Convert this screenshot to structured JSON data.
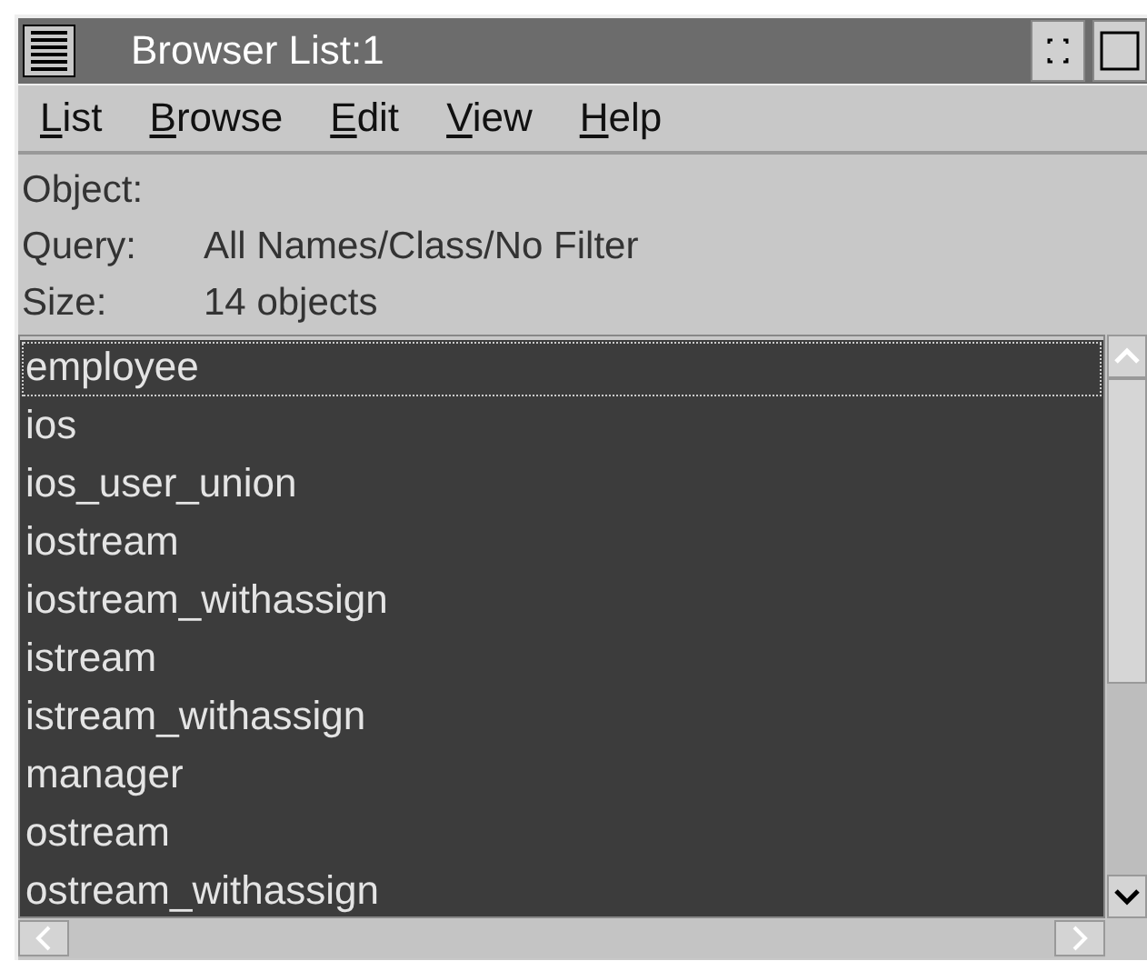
{
  "window": {
    "title": "Browser List:1"
  },
  "menu": [
    {
      "label": "List"
    },
    {
      "label": "Browse"
    },
    {
      "label": "Edit"
    },
    {
      "label": "View"
    },
    {
      "label": "Help"
    }
  ],
  "info": [
    {
      "label": "Object:"
    },
    {
      "label": "Query:",
      "value": "All Names/Class/No Filter"
    },
    {
      "label": "Size:",
      "value": "14 objects"
    }
  ],
  "list": [
    {
      "name": "employee",
      "selected": true,
      "focused": true
    },
    {
      "name": "ios",
      "selected": true,
      "focused": false
    },
    {
      "name": "ios_user_union",
      "selected": true,
      "focused": false
    },
    {
      "name": "iostream",
      "selected": true,
      "focused": false
    },
    {
      "name": "iostream_withassign",
      "selected": true,
      "focused": false
    },
    {
      "name": "istream",
      "selected": true,
      "focused": false
    },
    {
      "name": "istream_withassign",
      "selected": true,
      "focused": false
    },
    {
      "name": "manager",
      "selected": true,
      "focused": false
    },
    {
      "name": "ostream",
      "selected": true,
      "focused": false
    },
    {
      "name": "ostream_withassign",
      "selected": true,
      "focused": false
    }
  ]
}
